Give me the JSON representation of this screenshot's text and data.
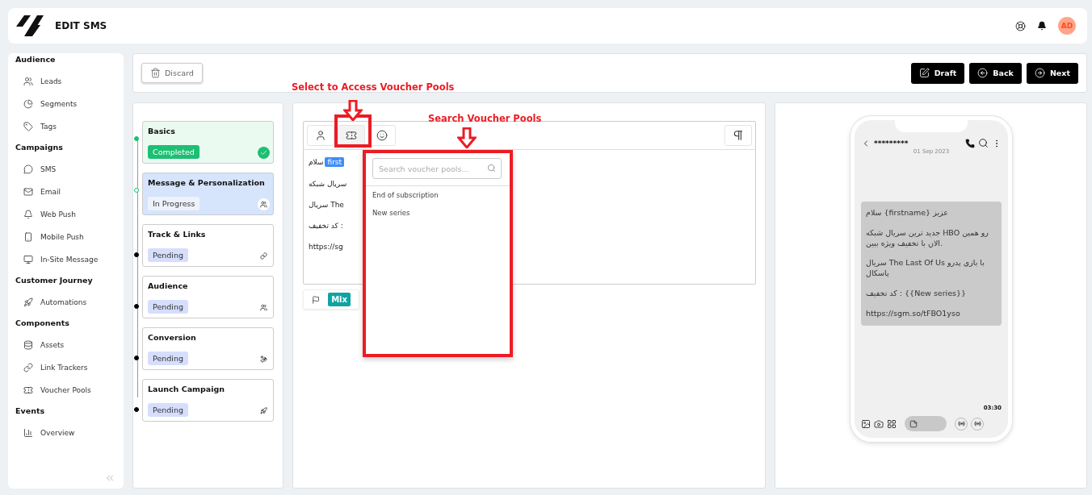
{
  "header": {
    "title": "EDIT SMS",
    "avatar": "AD"
  },
  "sidebar": {
    "sections": [
      {
        "title": "Audience",
        "items": [
          {
            "label": "Leads"
          },
          {
            "label": "Segments"
          },
          {
            "label": "Tags"
          }
        ]
      },
      {
        "title": "Campaigns",
        "items": [
          {
            "label": "SMS"
          },
          {
            "label": "Email"
          },
          {
            "label": "Web Push"
          },
          {
            "label": "Mobile Push"
          },
          {
            "label": "In-Site Message"
          }
        ]
      },
      {
        "title": "Customer Journey",
        "items": [
          {
            "label": "Automations"
          }
        ]
      },
      {
        "title": "Components",
        "items": [
          {
            "label": "Assets"
          },
          {
            "label": "Link Trackers"
          },
          {
            "label": "Voucher Pools"
          }
        ]
      },
      {
        "title": "Events",
        "items": [
          {
            "label": "Overview"
          }
        ]
      }
    ]
  },
  "toolbar": {
    "discard": "Discard",
    "buttons": [
      "Draft",
      "Back",
      "Next"
    ]
  },
  "steps": [
    {
      "title": "Basics",
      "kind": "completed",
      "badge": "Completed"
    },
    {
      "title": "Message & Personalization",
      "kind": "active",
      "badge": "In Progress"
    },
    {
      "title": "Track & Links",
      "kind": "pending",
      "badge": "Pending"
    },
    {
      "title": "Audience",
      "kind": "pending",
      "badge": "Pending"
    },
    {
      "title": "Conversion",
      "kind": "pending",
      "badge": "Pending"
    },
    {
      "title": "Launch Campaign",
      "kind": "pending",
      "badge": "Pending"
    }
  ],
  "editor": {
    "tools": [
      {
        "selected": false
      },
      {
        "selected": true
      },
      {
        "selected": false
      }
    ],
    "lines": [
      {
        "text": "سلام",
        "tag": "first"
      },
      {
        "text": "سریال شبکه"
      },
      {
        "text": "سریال The"
      },
      {
        "text": "کد تخفیف :"
      },
      {
        "text": "https://sg"
      }
    ],
    "footer_tag": "Mix"
  },
  "voucher_dropdown": {
    "placeholder": "Search voucher pools...",
    "options": [
      "End of subscription",
      "New series"
    ]
  },
  "annotations": [
    {
      "text": "Select to Access Voucher Pools"
    },
    {
      "text": "Search Voucher Pools"
    }
  ],
  "phone": {
    "contact": "*********",
    "date": "01 Sep 2023",
    "paragraphs": [
      "سلام {firstname} عزیز",
      "جدید ترین سریال شبکه HBO رو همین الان با تخفیف ویژه ببین.",
      "سریال The Last Of Us با بازی پدرو پاسکال",
      "کد تخفیف : {{New series}}",
      "https://sgm.so/tFBO1yso"
    ],
    "time": "03:30"
  }
}
